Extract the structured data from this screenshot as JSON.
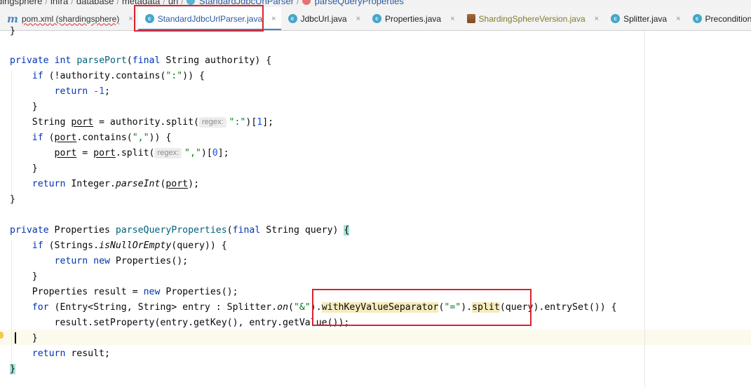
{
  "breadcrumb": {
    "items": [
      "dingsphere",
      "infra",
      "database",
      "metadata",
      "url",
      "StandardJdbcUrlParser",
      "parseQueryProperties"
    ],
    "separator": "/"
  },
  "tabs": [
    {
      "label": "pom.xml (shardingsphere)",
      "icon": "maven-icon",
      "style": "red"
    },
    {
      "label": "StandardJdbcUrlParser.java",
      "icon": "class-icon",
      "style": "blue",
      "active": true
    },
    {
      "label": "JdbcUrl.java",
      "icon": "class-icon",
      "style": "plain"
    },
    {
      "label": "Properties.java",
      "icon": "class-icon",
      "style": "plain"
    },
    {
      "label": "ShardingSphereVersion.java",
      "icon": "jar-class-icon",
      "style": "olive"
    },
    {
      "label": "Splitter.java",
      "icon": "class-icon",
      "style": "plain"
    },
    {
      "label": "Preconditions.java",
      "icon": "class-icon",
      "style": "plain"
    }
  ],
  "close_glyph": "×",
  "code": {
    "l0": "}",
    "l2": {
      "kw1": "private",
      "kw2": "int",
      "fn": "parsePort",
      "p1": "(",
      "kw3": "final",
      "rest": " String authority) {"
    },
    "l3": {
      "kw": "if",
      "a": " (!authority.contains(",
      "s": "\":\"",
      "b": ")) {"
    },
    "l4": {
      "kw": "return",
      "n": "-1",
      "b": ";"
    },
    "l5": "}",
    "l6": {
      "a": "String ",
      "v": "port",
      "b": " = authority.split(",
      "hint": "regex:",
      "s": "\":\"",
      "c": ")[",
      "n": "1",
      "d": "];"
    },
    "l7": {
      "kw": "if",
      "a": " (",
      "v": "port",
      "b": ".contains(",
      "s": "\",\"",
      "c": ")) {"
    },
    "l8": {
      "v1": "port",
      "a": " = ",
      "v2": "port",
      "b": ".split(",
      "hint": "regex:",
      "s": "\",\"",
      "c": ")[",
      "n": "0",
      "d": "];"
    },
    "l9": "}",
    "l10": {
      "kw": "return",
      "a": " Integer.",
      "f": "parseInt",
      "b": "(",
      "v": "port",
      "c": ");"
    },
    "l11": "}",
    "l13": {
      "kw1": "private",
      "a": " Properties ",
      "fn": "parseQueryProperties",
      "p1": "(",
      "kw2": "final",
      "rest": " String query) ",
      "brace": "{"
    },
    "l14": {
      "kw": "if",
      "a": " (Strings.",
      "f": "isNullOrEmpty",
      "b": "(query)) {"
    },
    "l15": {
      "kw1": "return",
      "kw2": "new",
      "a": " Properties();"
    },
    "l16": "}",
    "l17": {
      "a": "Properties result = ",
      "kw": "new",
      "b": " Properties();"
    },
    "l18": {
      "kw": "for",
      "a": " (Entry<String, String> entry : Splitter.",
      "f": "on",
      "b": "(",
      "s1": "\"&\"",
      "c": ")",
      "d": ".",
      "h1": "withKeyValueSeparator",
      "e": "(",
      "s2": "\"=\"",
      "g": ").",
      "h2": "split",
      "h": "(query).entrySet()) {"
    },
    "l19": "result.setProperty(entry.getKey(), entry.getValue());",
    "l20": "}",
    "l21": {
      "kw": "return",
      "a": " result;"
    },
    "l22": "}"
  }
}
